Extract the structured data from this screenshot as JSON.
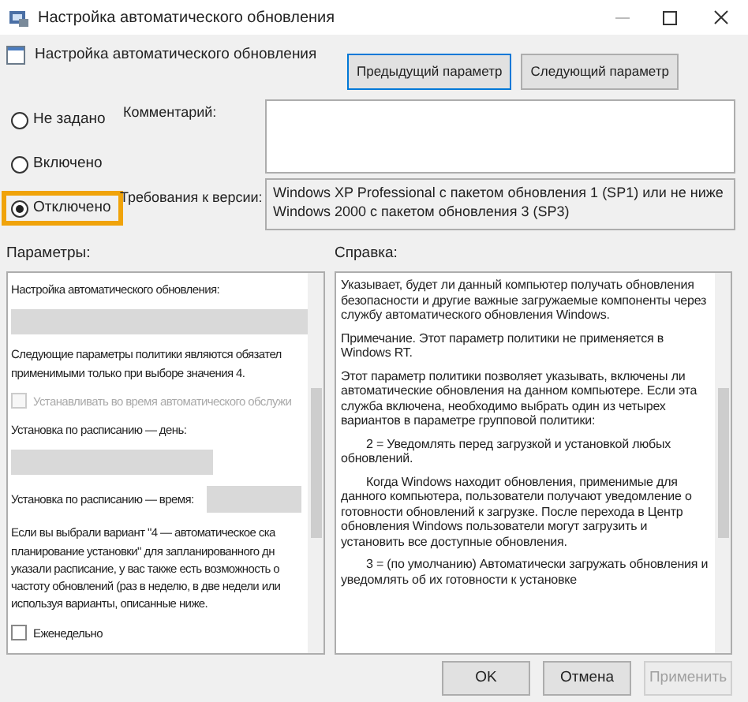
{
  "window": {
    "title": "Настройка автоматического обновления"
  },
  "header": {
    "title": "Настройка автоматического обновления",
    "buttons": [
      {
        "label": "Предыдущий параметр",
        "focused": true
      },
      {
        "label": "Следующий параметр",
        "focused": false
      }
    ]
  },
  "states": [
    {
      "label": "Не задано",
      "selected": false
    },
    {
      "label": "Включено",
      "selected": false
    },
    {
      "label": "Отключено",
      "selected": true
    }
  ],
  "comment": {
    "label": "Комментарий:"
  },
  "requirements": {
    "label": "Требования к версии:",
    "text": "Windows XP Professional с пакетом обновления 1 (SP1) или не ниже Windows 2000 с пакетом обновления 3 (SP3)"
  },
  "options": {
    "label": "Параметры:",
    "items": [
      {
        "kind": "label",
        "text": "Настройка автоматического обновления:"
      },
      {
        "kind": "select"
      },
      {
        "kind": "text",
        "lines": [
          "Следующие параметры политики являются обязател",
          "применимыми только при выборе значения 4."
        ]
      },
      {
        "kind": "checkbox",
        "label": "Устанавливать во время автоматического обслужи",
        "checked": false,
        "disabled": true
      },
      {
        "kind": "label",
        "text": "Установка по расписанию — день:"
      },
      {
        "kind": "select"
      },
      {
        "kind": "time",
        "text": "Установка по расписанию — время:"
      },
      {
        "kind": "text",
        "lines": [
          "Если вы  выбрали вариант \"4 — автоматическое ска",
          "планирование установки\" для запланированного дн",
          "указали расписание, у вас также есть возможность о",
          "частоту обновлений (раз в неделю, в две недели или",
          "используя варианты, описанные ниже."
        ]
      },
      {
        "kind": "checkbox",
        "label": "Еженедельно",
        "checked": false,
        "disabled": false
      }
    ]
  },
  "help": {
    "label": "Справка:",
    "paragraphs": [
      {
        "text": "Указывает, будет ли данный компьютер получать обновления безопасности и другие важные загружаемые компоненты через службу автоматического обновления Windows.",
        "indent": false
      },
      {
        "text": "Примечание. Этот параметр политики не применяется в Windows RT.",
        "indent": false
      },
      {
        "text": "Этот параметр политики позволяет указывать, включены ли автоматические обновления на данном компьютере. Если эта служба включена, необходимо выбрать один из четырех вариантов в параметре групповой политики:",
        "indent": false
      },
      {
        "text": "2 = Уведомлять перед загрузкой и установкой любых обновлений.",
        "indent": true
      },
      {
        "text": "Когда Windows находит обновления, применимые для данного компьютера, пользователи получают уведомление о готовности обновлений к загрузке. После перехода в Центр обновления Windows пользователи могут загрузить и установить все доступные обновления.",
        "indent": true
      },
      {
        "text": "3 = (по умолчанию) Автоматически загружать обновления и уведомлять об их готовности к установке",
        "indent": true
      }
    ]
  },
  "footer": [
    {
      "label": "OK",
      "disabled": false
    },
    {
      "label": "Отмена",
      "disabled": false
    },
    {
      "label": "Применить",
      "disabled": true
    }
  ]
}
